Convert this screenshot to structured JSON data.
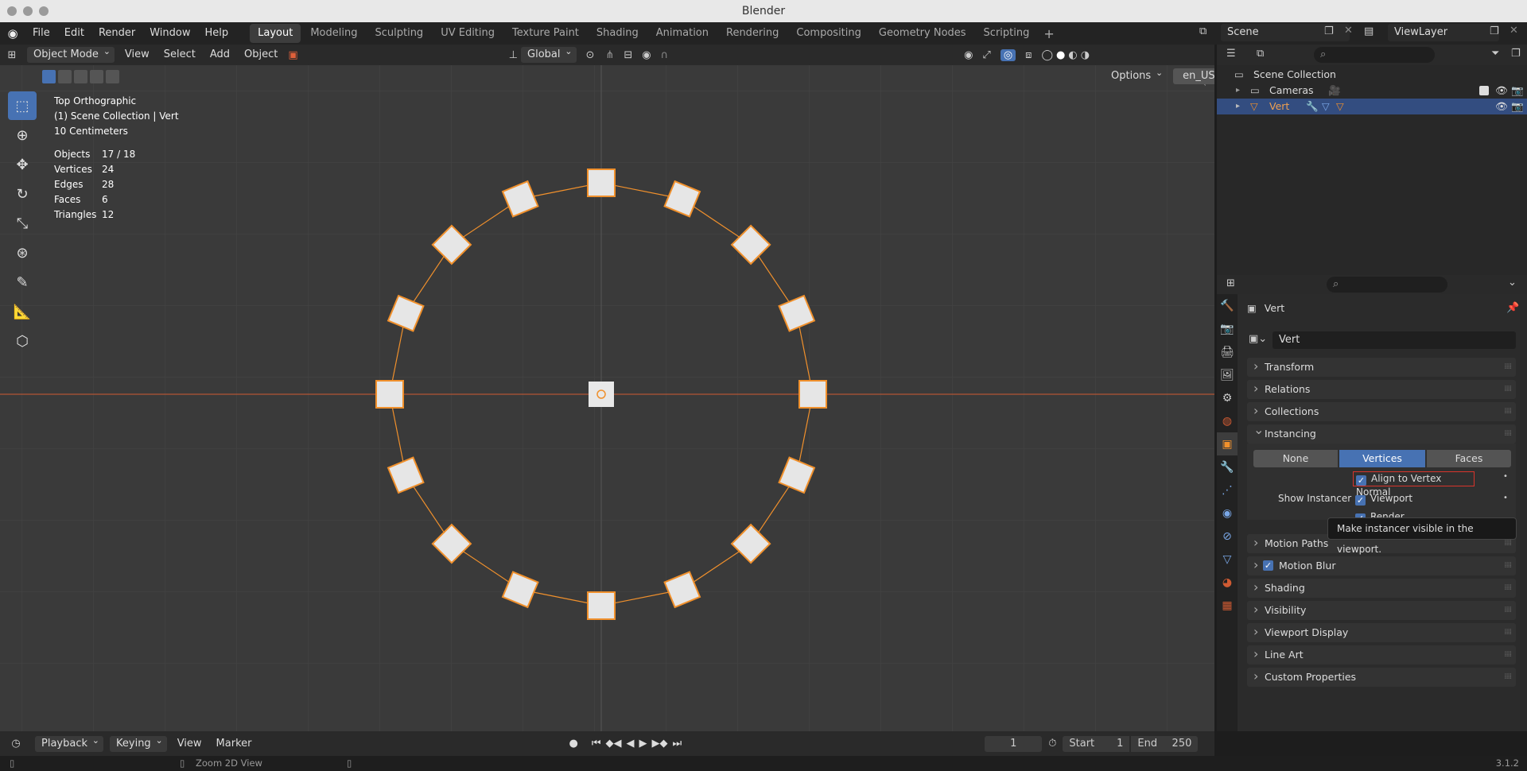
{
  "window": {
    "title": "Blender"
  },
  "menu": [
    "File",
    "Edit",
    "Render",
    "Window",
    "Help"
  ],
  "workspaces": [
    "Layout",
    "Modeling",
    "Sculpting",
    "UV Editing",
    "Texture Paint",
    "Shading",
    "Animation",
    "Rendering",
    "Compositing",
    "Geometry Nodes",
    "Scripting"
  ],
  "active_workspace": "Layout",
  "scene": {
    "name": "Scene",
    "view_layer": "ViewLayer"
  },
  "viewport_header": {
    "mode": "Object Mode",
    "menus": [
      "View",
      "Select",
      "Add",
      "Object"
    ],
    "transform_orientation": "Global",
    "options": "Options",
    "language": "en_US"
  },
  "overlay": {
    "view": "Top Orthographic",
    "collection": "(1) Scene Collection | Vert",
    "scale": "10 Centimeters",
    "stats": [
      {
        "label": "Objects",
        "value": "17 / 18"
      },
      {
        "label": "Vertices",
        "value": "24"
      },
      {
        "label": "Edges",
        "value": "28"
      },
      {
        "label": "Faces",
        "value": "6"
      },
      {
        "label": "Triangles",
        "value": "12"
      }
    ]
  },
  "outliner": {
    "root": "Scene Collection",
    "items": [
      {
        "name": "Cameras"
      },
      {
        "name": "Vert"
      }
    ]
  },
  "properties": {
    "object_name": "Vert",
    "data_name": "Vert",
    "panels": [
      "Transform",
      "Relations",
      "Collections",
      "Instancing",
      "Motion Paths",
      "Motion Blur",
      "Shading",
      "Visibility",
      "Viewport Display",
      "Line Art",
      "Custom Properties"
    ],
    "instancing": {
      "options": [
        "None",
        "Vertices",
        "Faces"
      ],
      "selected": "Vertices",
      "align_label": "Align to Vertex Normal",
      "show_instancer_label": "Show Instancer",
      "viewport_label": "Viewport",
      "render_label": "Render"
    },
    "tooltip": "Make instancer visible in the viewport."
  },
  "timeline": {
    "menus": [
      "Playback",
      "Keying",
      "View",
      "Marker"
    ],
    "current_frame": "1",
    "start_label": "Start",
    "start": "1",
    "end_label": "End",
    "end": "250"
  },
  "statusbar": {
    "hint": "Zoom 2D View",
    "version": "3.1.2"
  },
  "colors": {
    "accent": "#4772b3",
    "selection": "#f0902c",
    "axis_x": "#d05b33"
  }
}
